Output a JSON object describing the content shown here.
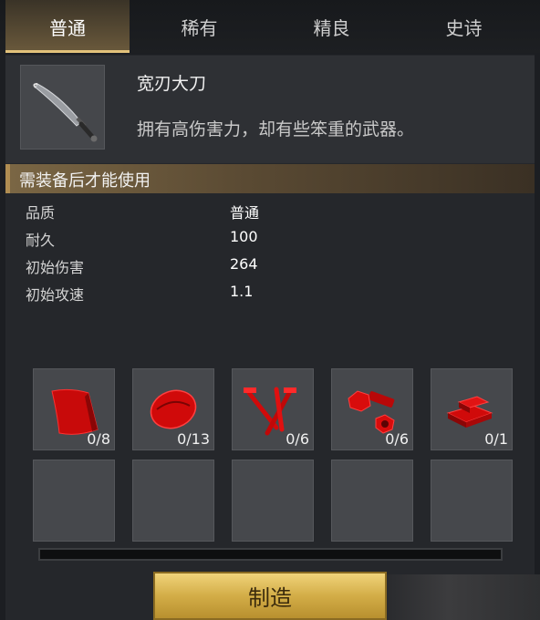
{
  "tabs": [
    {
      "label": "普通",
      "active": true
    },
    {
      "label": "稀有",
      "active": false
    },
    {
      "label": "精良",
      "active": false
    },
    {
      "label": "史诗",
      "active": false
    }
  ],
  "item": {
    "name": "宽刃大刀",
    "description": "拥有高伤害力，却有些笨重的武器。",
    "icon": "broad-blade-sword"
  },
  "requirement": "需装备后才能使用",
  "stats": [
    {
      "label": "品质",
      "value": "普通"
    },
    {
      "label": "耐久",
      "value": "100"
    },
    {
      "label": "初始伤害",
      "value": "264"
    },
    {
      "label": "初始攻速",
      "value": "1.1"
    }
  ],
  "materials": [
    {
      "icon": "red-cloth-icon",
      "count": "0/8"
    },
    {
      "icon": "red-ore-icon",
      "count": "0/13"
    },
    {
      "icon": "red-nails-icon",
      "count": "0/6"
    },
    {
      "icon": "red-bolt-nut-icon",
      "count": "0/6"
    },
    {
      "icon": "red-ingots-icon",
      "count": "0/1"
    }
  ],
  "empty_slots": 5,
  "progress": 0,
  "craft_button": "制造",
  "colors": {
    "accent_gold": "#e2c27a",
    "material_red": "#d01010"
  }
}
